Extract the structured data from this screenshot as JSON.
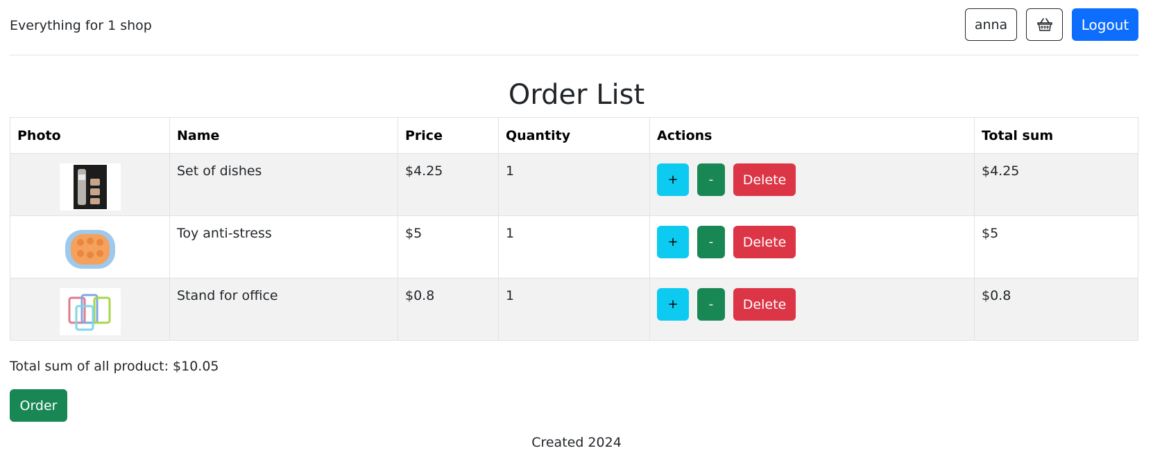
{
  "header": {
    "brand": "Everything for 1 shop",
    "user_label": "anna",
    "cart_icon": "basket-icon",
    "logout_label": "Logout"
  },
  "page": {
    "title": "Order List"
  },
  "table": {
    "columns": [
      "Photo",
      "Name",
      "Price",
      "Quantity",
      "Actions",
      "Total sum"
    ],
    "rows": [
      {
        "photo": "dishes-set-image",
        "name": "Set of dishes",
        "price": "$4.25",
        "quantity": "1",
        "total": "$4.25"
      },
      {
        "photo": "toy-anti-stress-image",
        "name": "Toy anti-stress",
        "price": "$5",
        "quantity": "1",
        "total": "$5"
      },
      {
        "photo": "office-stand-image",
        "name": "Stand for office",
        "price": "$0.8",
        "quantity": "1",
        "total": "$0.8"
      }
    ],
    "actions": {
      "plus": "+",
      "minus": "-",
      "delete": "Delete"
    }
  },
  "summary": {
    "total_text": "Total sum of all product: $10.05"
  },
  "order_label": "Order",
  "footer": "Created 2024",
  "colors": {
    "primary": "#0d6efd",
    "info": "#0dcaf0",
    "success": "#198754",
    "danger": "#dc3545"
  }
}
